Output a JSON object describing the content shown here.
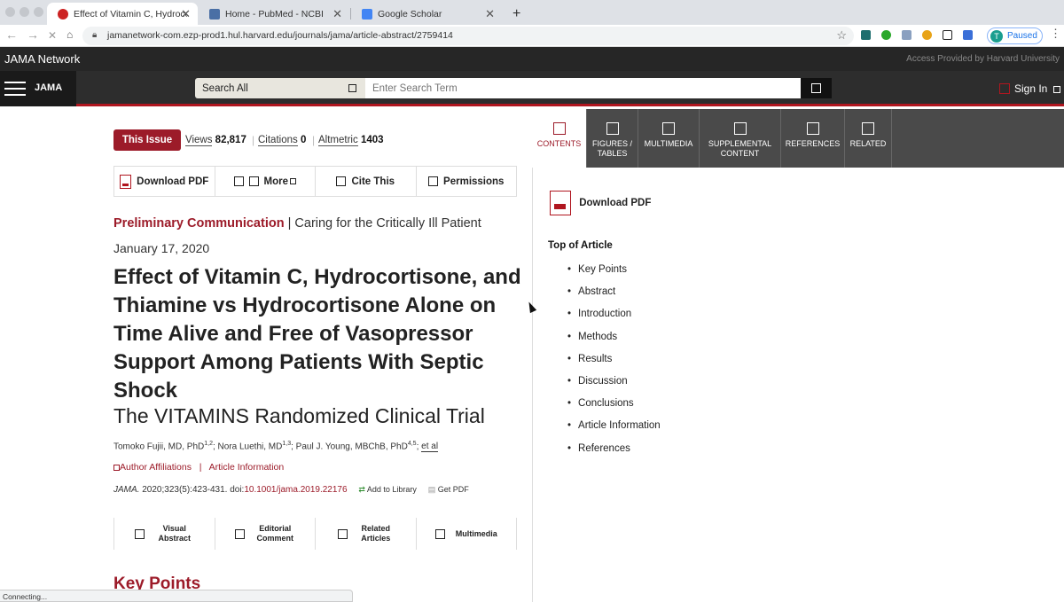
{
  "browser": {
    "tabs": [
      {
        "title": "Effect of Vitamin C, Hydrocortisone",
        "close": "✕"
      },
      {
        "title": "Home - PubMed - NCBI",
        "close": "✕"
      },
      {
        "title": "Google Scholar",
        "close": "✕"
      }
    ],
    "new_tab": "+",
    "url": "jamanetwork-com.ezp-prod1.hul.harvard.edu/journals/jama/article-abstract/2759414",
    "profile_initial": "T",
    "profile_status": "Paused",
    "status_bar": "Connecting..."
  },
  "site": {
    "logo": "JAMA Network",
    "access_text": "Access Provided by Harvard University",
    "journal_label": "JAMA",
    "search_scope": "Search All",
    "search_placeholder": "Enter Search Term",
    "sign_in": "Sign In"
  },
  "article": {
    "this_issue": "This Issue",
    "views_label": "Views",
    "views": "82,817",
    "citations_label": "Citations",
    "citations": "0",
    "altmetric_label": "Altmetric",
    "altmetric": "1403",
    "actions": {
      "download_pdf": "Download PDF",
      "more": "More",
      "cite_this": "Cite This",
      "permissions": "Permissions"
    },
    "category": "Preliminary Communication",
    "section": "Caring for the Critically Ill Patient",
    "date": "January 17, 2020",
    "title": "Effect of Vitamin C, Hydrocortisone, and Thiamine vs Hydrocortisone Alone on Time Alive and Free of Vasopressor Support Among Patients With Septic Shock",
    "subtitle": "The VITAMINS Randomized Clinical Trial",
    "authors": [
      {
        "name": "Tomoko Fujii, MD, PhD",
        "sup": "1,2"
      },
      {
        "name": "Nora Luethi, MD",
        "sup": "1,3"
      },
      {
        "name": "Paul J. Young, MBChB, PhD",
        "sup": "4,5"
      }
    ],
    "et_al": "et al",
    "author_affiliations": "Author Affiliations",
    "article_information": "Article Information",
    "journal_abbr": "JAMA.",
    "citation": "2020;323(5):423-431. doi:",
    "doi": "10.1001/jama.2019.22176",
    "add_to_library": "Add to Library",
    "get_pdf": "Get PDF",
    "related_buttons": [
      "Visual Abstract",
      "Editorial Comment",
      "Related Articles",
      "Multimedia"
    ],
    "key_points_heading": "Key Points"
  },
  "sidebar": {
    "tabs": [
      "CONTENTS",
      "FIGURES / TABLES",
      "MULTIMEDIA",
      "SUPPLEMENTAL CONTENT",
      "REFERENCES",
      "RELATED"
    ],
    "download_pdf": "Download PDF",
    "top_of_article": "Top of Article",
    "toc": [
      "Key Points",
      "Abstract",
      "Introduction",
      "Methods",
      "Results",
      "Discussion",
      "Conclusions",
      "Article Information",
      "References"
    ]
  }
}
